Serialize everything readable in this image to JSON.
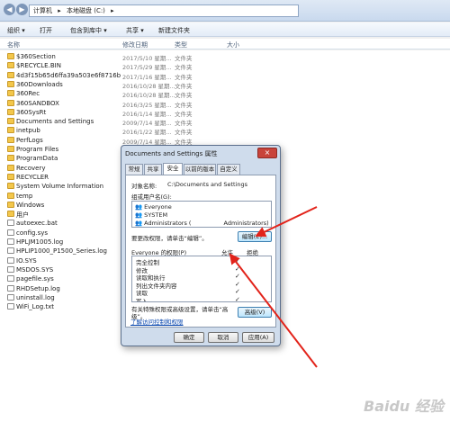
{
  "address": {
    "segments": [
      "计算机",
      "本地磁盘 (C:)"
    ],
    "back_icon": "back-arrow-icon",
    "forward_icon": "forward-arrow-icon"
  },
  "toolbar": {
    "items": [
      "组织 ▾",
      "打开",
      "包含到库中 ▾",
      "共享 ▾",
      "新建文件夹"
    ]
  },
  "columns": {
    "name": "名称",
    "date": "修改日期",
    "type": "类型",
    "size": "大小"
  },
  "files": [
    {
      "name": "$360Section",
      "date": "2017/5/10 星期...",
      "type": "文件夹",
      "kind": "folder"
    },
    {
      "name": "$RECYCLE.BIN",
      "date": "2017/5/29 星期...",
      "type": "文件夹",
      "kind": "folder"
    },
    {
      "name": "4d3f15b65d6ffa39a503e6f8716b",
      "date": "2017/1/16 星期...",
      "type": "文件夹",
      "kind": "folder"
    },
    {
      "name": "360Downloads",
      "date": "2016/10/28 星期...",
      "type": "文件夹",
      "kind": "folder"
    },
    {
      "name": "360Rec",
      "date": "2016/10/28 星期...",
      "type": "文件夹",
      "kind": "folder"
    },
    {
      "name": "360SANDBOX",
      "date": "2016/3/25 星期...",
      "type": "文件夹",
      "kind": "folder"
    },
    {
      "name": "360SysRt",
      "date": "2016/1/14 星期...",
      "type": "文件夹",
      "kind": "folder"
    },
    {
      "name": "Documents and Settings",
      "date": "2009/7/14 星期...",
      "type": "文件夹",
      "kind": "folder"
    },
    {
      "name": "inetpub",
      "date": "2016/1/22 星期...",
      "type": "文件夹",
      "kind": "folder"
    },
    {
      "name": "PerfLogs",
      "date": "2009/7/14 星期...",
      "type": "文件夹",
      "kind": "folder"
    },
    {
      "name": "Program Files",
      "date": "",
      "type": "",
      "kind": "folder"
    },
    {
      "name": "ProgramData",
      "date": "",
      "type": "",
      "kind": "folder"
    },
    {
      "name": "Recovery",
      "date": "",
      "type": "",
      "kind": "folder"
    },
    {
      "name": "RECYCLER",
      "date": "",
      "type": "",
      "kind": "folder"
    },
    {
      "name": "System Volume Information",
      "date": "",
      "type": "",
      "kind": "folder"
    },
    {
      "name": "temp",
      "date": "",
      "type": "",
      "kind": "folder"
    },
    {
      "name": "Windows",
      "date": "",
      "type": "",
      "kind": "folder"
    },
    {
      "name": "用户",
      "date": "",
      "type": "",
      "kind": "folder"
    },
    {
      "name": "autoexec.bat",
      "date": "",
      "type": "",
      "kind": "file"
    },
    {
      "name": "config.sys",
      "date": "",
      "type": "",
      "kind": "file"
    },
    {
      "name": "HPLJM1005.log",
      "date": "",
      "type": "",
      "kind": "file"
    },
    {
      "name": "HPLIP1000_P1500_Series.log",
      "date": "",
      "type": "",
      "kind": "file"
    },
    {
      "name": "IO.SYS",
      "date": "",
      "type": "",
      "kind": "file"
    },
    {
      "name": "MSDOS.SYS",
      "date": "",
      "type": "",
      "kind": "file"
    },
    {
      "name": "pagefile.sys",
      "date": "",
      "type": "",
      "kind": "file"
    },
    {
      "name": "RHDSetup.log",
      "date": "",
      "type": "",
      "kind": "file"
    },
    {
      "name": "uninstall.log",
      "date": "",
      "type": "",
      "kind": "file"
    },
    {
      "name": "WiFi_Log.txt",
      "date": "",
      "type": "",
      "kind": "file"
    }
  ],
  "dialog": {
    "title": "Documents and Settings 属性",
    "close": "×",
    "tabs": [
      "常规",
      "共享",
      "安全",
      "以前的版本",
      "自定义"
    ],
    "object_label": "对象名称:",
    "object_value": "C:\\Documents and Settings",
    "group_label": "组或用户名(G):",
    "users": [
      "Everyone",
      "SYSTEM",
      "Administrators (",
      "Administrators)"
    ],
    "change_hint": "要更改权限，请单击“编辑”。",
    "edit_button": "编辑(E)...",
    "perm_header": "Everyone 的权限(P)",
    "allow": "允许",
    "deny": "拒绝",
    "perms": [
      "完全控制",
      "修改",
      "读取和执行",
      "列出文件夹内容",
      "读取",
      "写入"
    ],
    "checks": [
      "✓",
      "✓",
      "✓",
      "✓",
      "✓",
      "✓"
    ],
    "special_hint": "有关特殊权限或高级设置，请单击“高级”。",
    "advanced_button": "高级(V)",
    "link": "了解访问控制和权限",
    "ok": "确定",
    "cancel": "取消",
    "apply": "应用(A)"
  },
  "watermark": "Baidu 经验",
  "colors": {
    "arrow": "#e2231a",
    "folder": "#f3c74b"
  }
}
